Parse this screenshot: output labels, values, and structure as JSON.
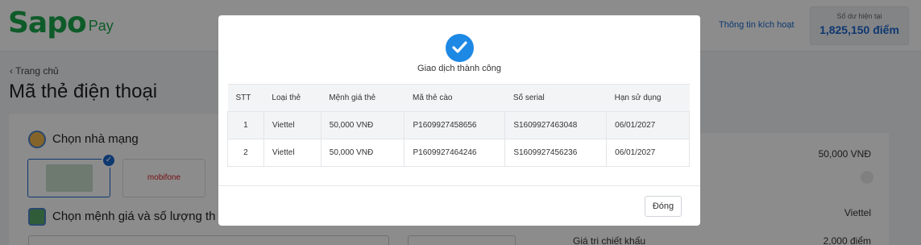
{
  "header": {
    "logo_main": "Sapo",
    "logo_sub": "Pay",
    "activate_link": "Thông tin kích hoạt",
    "balance_label": "Số dư hiện tại",
    "balance_value": "1,825,150 điểm"
  },
  "page": {
    "breadcrumb": "Trang chủ",
    "title": "Mã thẻ điện thoại"
  },
  "form": {
    "carrier_section_title": "Chọn nhà mạng",
    "carriers": [
      {
        "name": "",
        "selected": true
      },
      {
        "name": "mobifone",
        "selected": false
      }
    ],
    "amount_section_title": "Chọn mệnh giá và số lượng th"
  },
  "summary": {
    "rows": [
      {
        "label": "",
        "value": "50,000 VNĐ"
      },
      {
        "label": "",
        "value": "Viettel"
      },
      {
        "label": "Giá trị chiết khấu",
        "value": "2,000 điểm"
      }
    ]
  },
  "modal": {
    "status_text": "Giao dịch thành công",
    "columns": [
      "STT",
      "Loại thẻ",
      "Mệnh giá thẻ",
      "Mã thẻ cào",
      "Số serial",
      "Hạn sử dụng"
    ],
    "rows": [
      {
        "stt": "1",
        "type": "Viettel",
        "value": "50,000 VNĐ",
        "code": "P1609927458656",
        "serial": "S1609927463048",
        "expiry": "06/01/2027"
      },
      {
        "stt": "2",
        "type": "Viettel",
        "value": "50,000 VNĐ",
        "code": "P1609927464246",
        "serial": "S1609927456236",
        "expiry": "06/01/2027"
      }
    ],
    "close_label": "Đóng"
  },
  "icons": {
    "success": "check-circle-icon",
    "breadcrumb": "chevron-left-icon"
  },
  "colors": {
    "brand_green": "#1aa64b",
    "accent_blue": "#1a66cc",
    "success_blue": "#1e88e5"
  }
}
